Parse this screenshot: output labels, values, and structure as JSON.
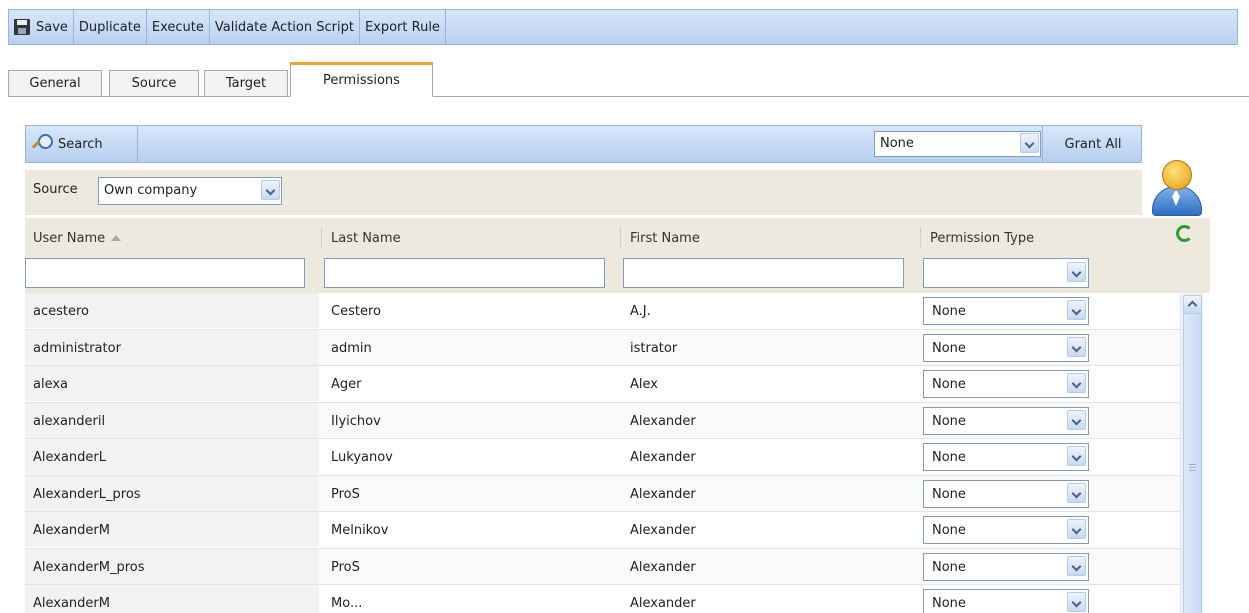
{
  "toolbar": {
    "items": [
      "Save",
      "Duplicate",
      "Execute",
      "Validate Action Script",
      "Export Rule"
    ]
  },
  "tabs": [
    "General",
    "Source",
    "Target",
    "Permissions"
  ],
  "active_tab": "Permissions",
  "search": {
    "label": "Search",
    "grant_value": "None",
    "grant_all_label": "Grant All"
  },
  "source": {
    "label": "Source",
    "value": "Own company"
  },
  "grid": {
    "columns": [
      "User Name",
      "Last Name",
      "First Name",
      "Permission Type"
    ],
    "sorted_column": "User Name",
    "rows": [
      {
        "user": "acestero",
        "last": "Cestero",
        "first": "A.J.",
        "perm": "None"
      },
      {
        "user": "administrator",
        "last": "admin",
        "first": "istrator",
        "perm": "None"
      },
      {
        "user": "alexa",
        "last": "Ager",
        "first": "Alex",
        "perm": "None"
      },
      {
        "user": "alexanderil",
        "last": "Ilyichov",
        "first": "Alexander",
        "perm": "None"
      },
      {
        "user": "AlexanderL",
        "last": "Lukyanov",
        "first": "Alexander",
        "perm": "None"
      },
      {
        "user": "AlexanderL_pros",
        "last": "ProS",
        "first": "Alexander",
        "perm": "None"
      },
      {
        "user": "AlexanderM",
        "last": "Melnikov",
        "first": "Alexander",
        "perm": "None"
      },
      {
        "user": "AlexanderM_pros",
        "last": "ProS",
        "first": "Alexander",
        "perm": "None"
      },
      {
        "user": "AlexanderM",
        "last": "Mo...",
        "first": "Alexander",
        "perm": "None"
      }
    ]
  },
  "colors": {
    "toolbar_bg": "#c6dbf5",
    "tab_accent": "#f0a030",
    "header_bg": "#ede9df"
  }
}
